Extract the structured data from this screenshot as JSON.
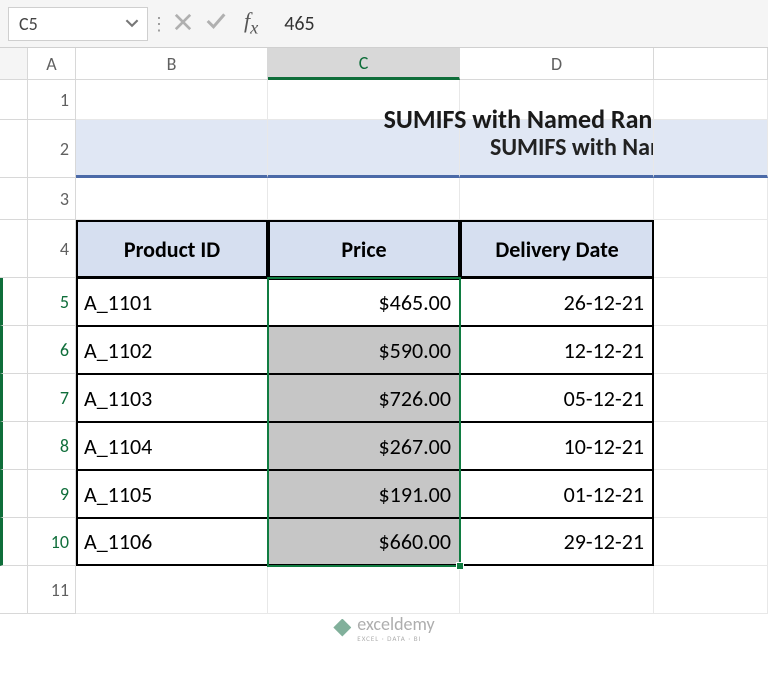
{
  "nameBox": {
    "value": "C5"
  },
  "formulaBar": {
    "value": "465"
  },
  "columnHeaders": [
    "A",
    "B",
    "C",
    "D"
  ],
  "rowHeaders": [
    "1",
    "2",
    "3",
    "4",
    "5",
    "6",
    "7",
    "8",
    "9",
    "10",
    "11"
  ],
  "title": "SUMIFS with Named Ran",
  "tableHeaders": {
    "col1": "Product ID",
    "col2": "Price",
    "col3": "Delivery Date"
  },
  "rows": [
    {
      "id": "A_1101",
      "price": "$465.00",
      "date": "26-12-21"
    },
    {
      "id": "A_1102",
      "price": "$590.00",
      "date": "12-12-21"
    },
    {
      "id": "A_1103",
      "price": "$726.00",
      "date": "05-12-21"
    },
    {
      "id": "A_1104",
      "price": "$267.00",
      "date": "10-12-21"
    },
    {
      "id": "A_1105",
      "price": "$191.00",
      "date": "01-12-21"
    },
    {
      "id": "A_1106",
      "price": "$660.00",
      "date": "29-12-21"
    }
  ],
  "watermark": {
    "name": "exceldemy",
    "tag": "EXCEL · DATA · BI"
  },
  "activeCell": "C5",
  "selectionRange": "C5:C10"
}
